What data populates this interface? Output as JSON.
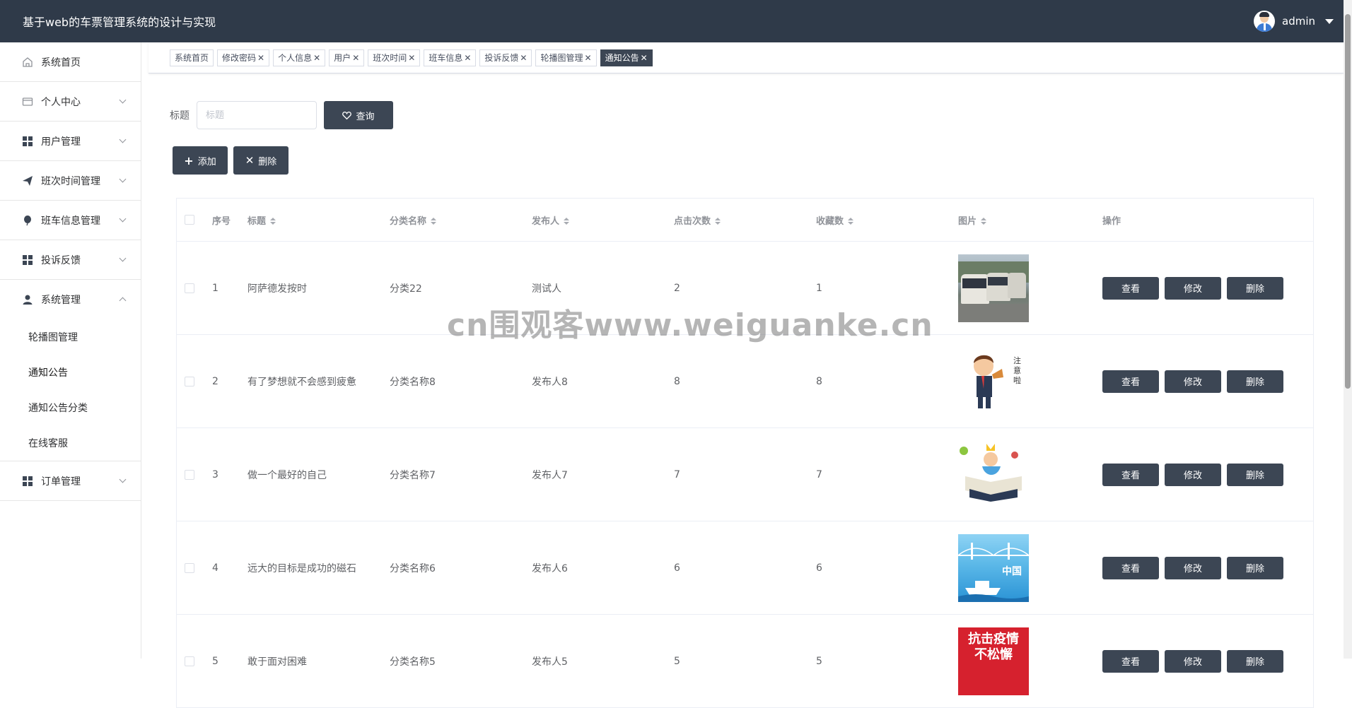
{
  "header": {
    "title": "基于web的车票管理系统的设计与实现",
    "username": "admin"
  },
  "sidebar": {
    "items": [
      {
        "label": "系统首页",
        "icon": "home-icon",
        "expandable": false
      },
      {
        "label": "个人中心",
        "icon": "card-icon",
        "expandable": true
      },
      {
        "label": "用户管理",
        "icon": "grid-icon",
        "expandable": true
      },
      {
        "label": "班次时间管理",
        "icon": "send-icon",
        "expandable": true
      },
      {
        "label": "班车信息管理",
        "icon": "balloon-icon",
        "expandable": true
      },
      {
        "label": "投诉反馈",
        "icon": "grid-icon",
        "expandable": true
      },
      {
        "label": "系统管理",
        "icon": "user-icon",
        "expandable": true,
        "expanded": true
      },
      {
        "label": "订单管理",
        "icon": "grid-icon",
        "expandable": true
      }
    ],
    "submenu": [
      "轮播图管理",
      "通知公告",
      "通知公告分类",
      "在线客服"
    ]
  },
  "tags": [
    "系统首页",
    "修改密码",
    "个人信息",
    "用户",
    "班次时间",
    "班车信息",
    "投诉反馈",
    "轮播图管理",
    "通知公告"
  ],
  "search": {
    "label": "标题",
    "placeholder": "标题",
    "button": "查询"
  },
  "actions": {
    "add": "添加",
    "delete": "删除"
  },
  "table": {
    "headers": [
      "序号",
      "标题",
      "分类名称",
      "发布人",
      "点击次数",
      "收藏数",
      "图片",
      "操作"
    ],
    "rows": [
      {
        "no": "1",
        "title": "阿萨德发按时",
        "category": "分类22",
        "publisher": "测试人",
        "clicks": "2",
        "favorites": "1",
        "image": "bus-photo"
      },
      {
        "no": "2",
        "title": "有了梦想就不会感到疲惫",
        "category": "分类名称8",
        "publisher": "发布人8",
        "clicks": "8",
        "favorites": "8",
        "image": "cartoon-man"
      },
      {
        "no": "3",
        "title": "做一个最好的自己",
        "category": "分类名称7",
        "publisher": "发布人7",
        "clicks": "7",
        "favorites": "7",
        "image": "cartoon-book"
      },
      {
        "no": "4",
        "title": "远大的目标是成功的磁石",
        "category": "分类名称6",
        "publisher": "发布人6",
        "clicks": "6",
        "favorites": "6",
        "image": "china-bridge"
      },
      {
        "no": "5",
        "title": "敢于面对困难",
        "category": "分类名称5",
        "publisher": "发布人5",
        "clicks": "5",
        "favorites": "5",
        "image": "poster-red"
      }
    ],
    "row_buttons": {
      "view": "查看",
      "edit": "修改",
      "delete": "删除"
    }
  },
  "thumbnail_texts": {
    "cartoon_sign": "注意啦",
    "china": "中国",
    "poster_line1": "抗击疫情",
    "poster_line2": "不松懈"
  },
  "watermark": "cn围观客www.weiguanke.cn",
  "colors": {
    "header_bg": "#2f3a49",
    "button_bg": "#3c4654"
  }
}
